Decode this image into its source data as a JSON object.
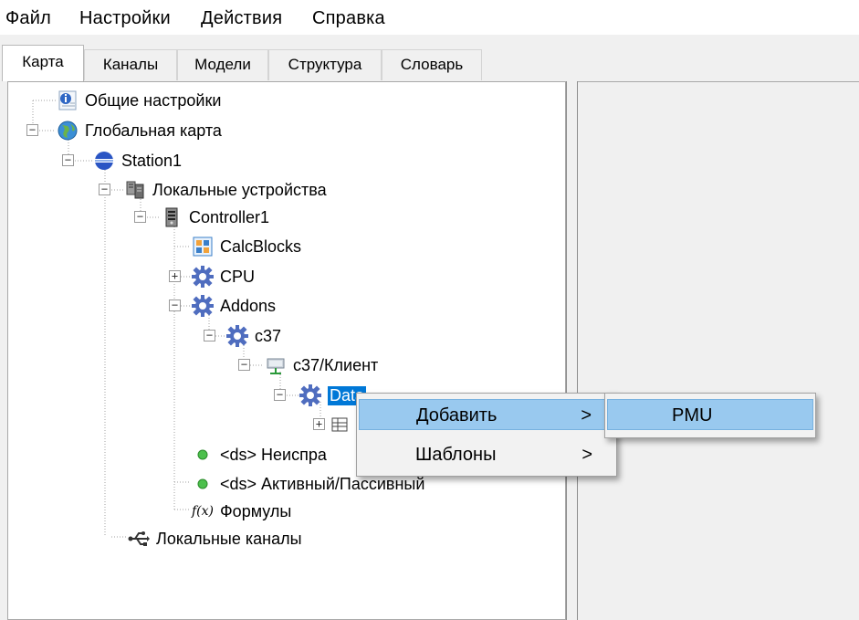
{
  "menubar": {
    "items": [
      "Файл",
      "Настройки",
      "Действия",
      "Справка"
    ]
  },
  "tabs": [
    "Карта",
    "Каналы",
    "Модели",
    "Структура",
    "Словарь"
  ],
  "tree": {
    "general_settings": "Общие настройки",
    "global_map": "Глобальная карта",
    "station1": "Station1",
    "local_devices": "Локальные устройства",
    "controller1": "Controller1",
    "calcblocks": "CalcBlocks",
    "cpu": "CPU",
    "addons": "Addons",
    "c37": "c37",
    "c37_client": "c37/Клиент",
    "data_selected": "Data",
    "ds_faulty": "<ds> Неиспра",
    "ds_active": "<ds> Активный/Пассивный",
    "formulas_icon_text": "f(x)",
    "formulas": "Формулы",
    "local_channels": "Локальные каналы"
  },
  "context_menu": {
    "items": [
      {
        "label": "Добавить",
        "arrow": ">"
      },
      {
        "label": "Шаблоны",
        "arrow": ">"
      }
    ]
  },
  "submenu": {
    "items": [
      {
        "label": "PMU"
      }
    ]
  },
  "colors": {
    "selection": "#0078d7",
    "menu_highlight": "#99c9ef",
    "gear": "#4f6dbf"
  }
}
